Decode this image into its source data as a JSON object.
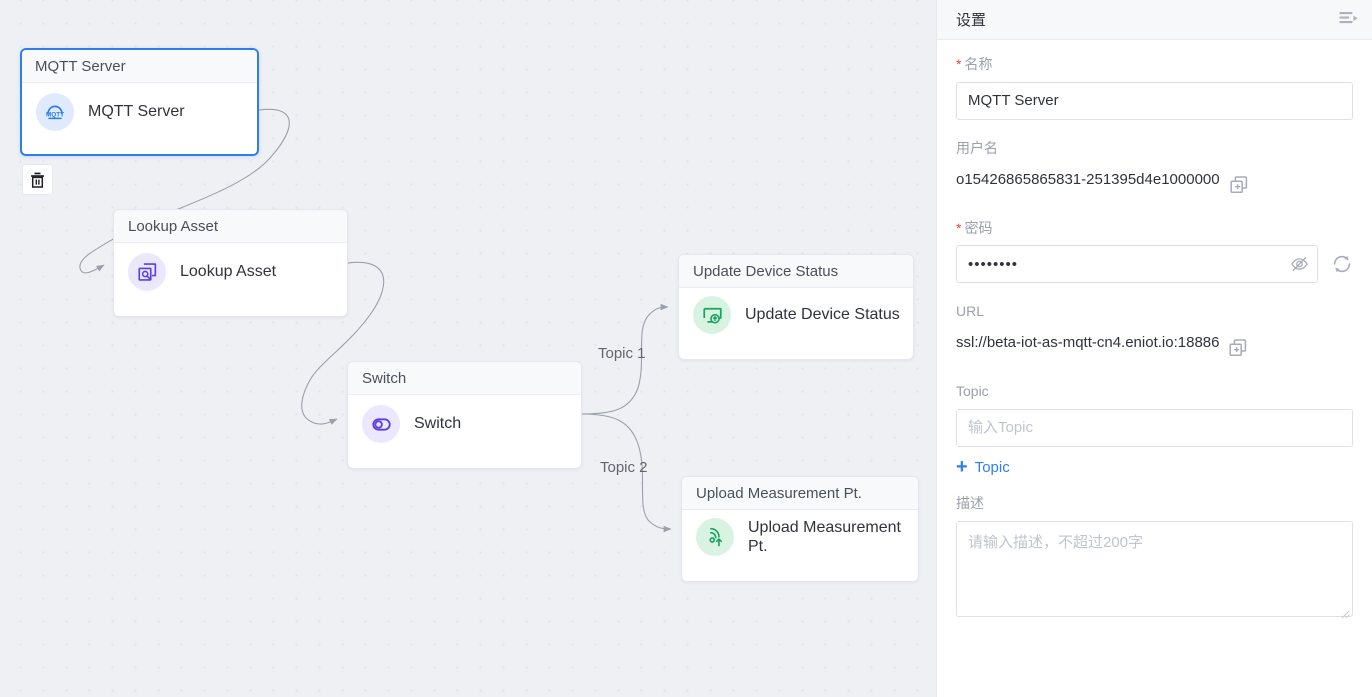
{
  "canvas": {
    "nodes": [
      {
        "id": "mqtt",
        "header": "MQTT Server",
        "label": "MQTT Server",
        "icon": "mqtt-cloud-icon",
        "icon_color": "#2f7ef0",
        "icon_bg": "#dfeafd",
        "selected": true
      },
      {
        "id": "lookup",
        "header": "Lookup Asset",
        "label": "Lookup Asset",
        "icon": "lookup-asset-icon",
        "icon_color": "#5b3ee8",
        "icon_bg": "#ebe8fd",
        "selected": false
      },
      {
        "id": "switch",
        "header": "Switch",
        "label": "Switch",
        "icon": "switch-icon",
        "icon_color": "#5b3ee8",
        "icon_bg": "#ebe8fd",
        "selected": false
      },
      {
        "id": "update",
        "header": "Update Device Status",
        "label": "Update Device Status",
        "icon": "update-device-status-icon",
        "icon_color": "#17a463",
        "icon_bg": "#d9f3e2",
        "selected": false
      },
      {
        "id": "upload",
        "header": "Upload Measurement Pt.",
        "label": "Upload Measurement Pt.",
        "icon": "upload-measurement-icon",
        "icon_color": "#17a463",
        "icon_bg": "#d9f3e2",
        "selected": false
      }
    ],
    "edge_labels": {
      "topic1": "Topic 1",
      "topic2": "Topic 2"
    },
    "toolbar": {
      "delete_icon": "trash-icon"
    },
    "background_color": "#eff0f4",
    "selected_border_color": "#2f7ef0"
  },
  "panel": {
    "title": "设置",
    "collapse_icon": "collapse-panel-icon",
    "fields": {
      "name": {
        "label": "名称",
        "required": true,
        "value": "MQTT Server"
      },
      "username": {
        "label": "用户名",
        "required": false,
        "value": "o15426865865831-251395d4e1000000",
        "copy_icon": "copy-icon"
      },
      "password": {
        "label": "密码",
        "required": true,
        "value": "••••••••",
        "eye_icon": "eye-off-icon",
        "refresh_icon": "refresh-icon"
      },
      "url": {
        "label": "URL",
        "required": false,
        "value": "ssl://beta-iot-as-mqtt-cn4.eniot.io:18886",
        "copy_icon": "copy-icon"
      },
      "topic": {
        "label": "Topic",
        "required": false,
        "value": "",
        "placeholder": "输入Topic"
      },
      "add_topic": {
        "label": "Topic",
        "plus": "+",
        "color": "#2d7ff2"
      },
      "description": {
        "label": "描述",
        "required": false,
        "value": "",
        "placeholder": "请输入描述，不超过200字"
      }
    }
  }
}
